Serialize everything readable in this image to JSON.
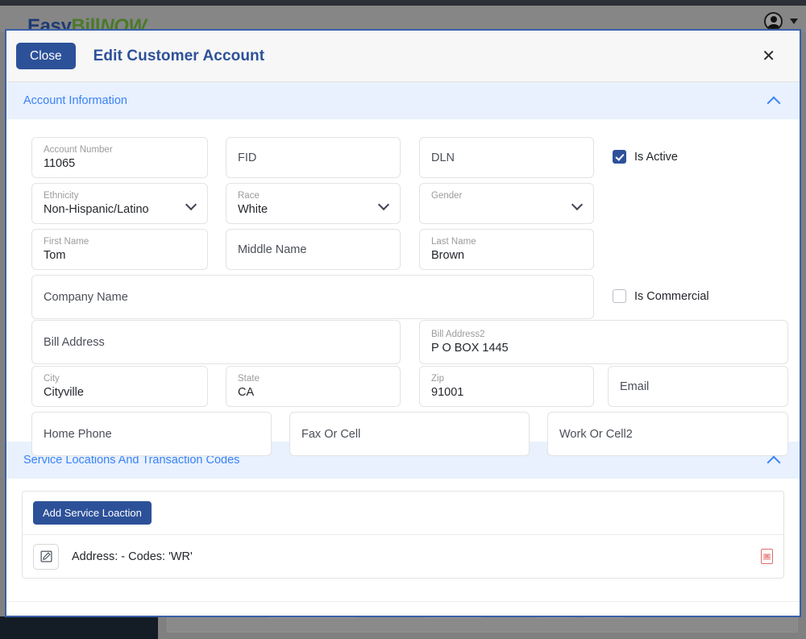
{
  "app": {
    "brand": {
      "part1": "Easy",
      "part2": "Bill",
      "part3": "NOW"
    },
    "avatar_icon": "user-avatar-icon",
    "caret_icon": "chevron-down-icon"
  },
  "modal": {
    "close_button_label": "Close",
    "title": "Edit Customer Account",
    "dismiss_icon": "close-x-icon"
  },
  "sections": {
    "account_information": {
      "title": "Account Information",
      "collapse_icon": "chevron-up-icon"
    },
    "service_locations": {
      "title": "Service Locations And Transaction Codes",
      "collapse_icon": "chevron-up-icon",
      "add_button_label": "Add Service Loaction",
      "rows": [
        {
          "text": "Address: - Codes: 'WR'",
          "edit_icon": "edit-pencil-square-icon",
          "delete_icon": "delete-red-icon"
        }
      ]
    }
  },
  "form": {
    "account_number": {
      "label": "Account Number",
      "value": "11065"
    },
    "fid": {
      "placeholder": "FID",
      "value": ""
    },
    "dln": {
      "placeholder": "DLN",
      "value": ""
    },
    "is_active": {
      "label": "Is Active",
      "checked": true
    },
    "ethnicity": {
      "label": "Ethnicity",
      "value": "Non-Hispanic/Latino"
    },
    "race": {
      "label": "Race",
      "value": "White"
    },
    "gender": {
      "label": "Gender",
      "value": ""
    },
    "first_name": {
      "label": "First Name",
      "value": "Tom"
    },
    "middle_name": {
      "placeholder": "Middle Name",
      "value": ""
    },
    "last_name": {
      "label": "Last Name",
      "value": "Brown"
    },
    "company_name": {
      "placeholder": "Company Name",
      "value": ""
    },
    "is_commercial": {
      "label": "Is Commercial",
      "checked": false
    },
    "bill_address": {
      "placeholder": "Bill Address",
      "value": ""
    },
    "bill_address2": {
      "label": "Bill Address2",
      "value": "P O BOX 1445"
    },
    "city": {
      "label": "City",
      "value": "Cityville"
    },
    "state": {
      "label": "State",
      "value": "CA"
    },
    "zip": {
      "label": "Zip",
      "value": "91001"
    },
    "email": {
      "placeholder": "Email",
      "value": ""
    },
    "home_phone": {
      "placeholder": "Home Phone",
      "value": ""
    },
    "fax_or_cell": {
      "placeholder": "Fax Or Cell",
      "value": ""
    },
    "work_or_cell2": {
      "placeholder": "Work Or Cell2",
      "value": ""
    }
  },
  "colors": {
    "primary": "#2d5199",
    "section_bg": "#e8f1fd",
    "section_text": "#3b82f6",
    "danger": "#e06b6b",
    "brand_blue": "#1f3b73",
    "brand_green": "#4a7a2a"
  }
}
